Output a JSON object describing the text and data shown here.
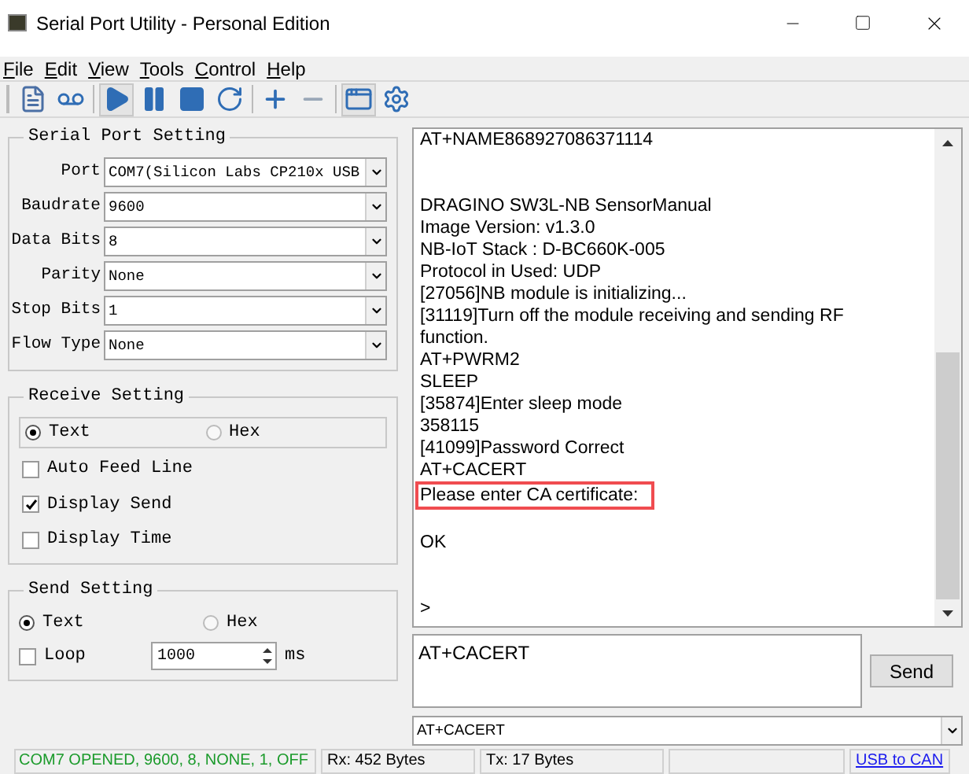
{
  "window": {
    "title": "Serial Port Utility - Personal Edition"
  },
  "menu": [
    {
      "label": "File"
    },
    {
      "label": "Edit"
    },
    {
      "label": "View"
    },
    {
      "label": "Tools"
    },
    {
      "label": "Control"
    },
    {
      "label": "Help"
    }
  ],
  "toolbar": [
    {
      "kind": "file",
      "selected": false
    },
    {
      "kind": "tape",
      "selected": false
    },
    {
      "kind": "play",
      "selected": true
    },
    {
      "kind": "pause",
      "selected": false
    },
    {
      "kind": "stop",
      "selected": false
    },
    {
      "kind": "refresh",
      "selected": false
    },
    {
      "kind": "plus",
      "selected": false
    },
    {
      "kind": "minus",
      "selected": false
    },
    {
      "kind": "window",
      "selected": true
    },
    {
      "kind": "gear",
      "selected": false
    }
  ],
  "serial_port_setting": {
    "title": "Serial Port Setting",
    "fields": [
      {
        "label": "Port",
        "value": "COM7(Silicon Labs CP210x USB"
      },
      {
        "label": "Baudrate",
        "value": "9600"
      },
      {
        "label": "Data Bits",
        "value": "8"
      },
      {
        "label": "Parity",
        "value": "None"
      },
      {
        "label": "Stop Bits",
        "value": "1"
      },
      {
        "label": "Flow Type",
        "value": "None"
      }
    ]
  },
  "receive_setting": {
    "title": "Receive Setting",
    "modes": [
      {
        "label": "Text",
        "selected": true
      },
      {
        "label": "Hex",
        "selected": false
      }
    ],
    "options": [
      {
        "label": "Auto Feed Line",
        "checked": false
      },
      {
        "label": "Display Send",
        "checked": true
      },
      {
        "label": "Display Time",
        "checked": false
      }
    ]
  },
  "send_setting": {
    "title": "Send Setting",
    "modes": [
      {
        "label": "Text",
        "selected": true
      },
      {
        "label": "Hex",
        "selected": false
      }
    ],
    "loop": {
      "label": "Loop",
      "checked": false,
      "value": "1000",
      "unit": "ms"
    }
  },
  "receive_log": [
    {
      "kind": "text",
      "text": "AT+NAME868927086371114",
      "highlighted": false
    },
    {
      "kind": "blank"
    },
    {
      "kind": "blank"
    },
    {
      "text": "DRAGINO SW3L-NB SensorManual",
      "highlighted": false
    },
    {
      "text": "Image Version: v1.3.0",
      "highlighted": false
    },
    {
      "text": "NB-IoT Stack : D-BC660K-005",
      "highlighted": false
    },
    {
      "text": "Protocol in Used: UDP",
      "highlighted": false
    },
    {
      "text": "[27056]NB module is initializing...",
      "highlighted": false
    },
    {
      "text": "[31119]Turn off the module receiving and sending RF function.",
      "highlighted": false
    },
    {
      "text": "AT+PWRM2",
      "highlighted": false
    },
    {
      "text": "SLEEP",
      "highlighted": false
    },
    {
      "text": "[35874]Enter sleep mode",
      "highlighted": false
    },
    {
      "text": "358115",
      "highlighted": false
    },
    {
      "text": "[41099]Password Correct",
      "highlighted": false
    },
    {
      "text": "AT+CACERT",
      "highlighted": false
    },
    {
      "text": "Please enter CA certificate:",
      "highlighted": true
    },
    {
      "kind": "blank"
    },
    {
      "text": "OK",
      "highlighted": false
    },
    {
      "kind": "blank"
    },
    {
      "kind": "blank"
    },
    {
      "text": ">",
      "highlighted": false
    }
  ],
  "send_input": {
    "value": "AT+CACERT"
  },
  "send_button": {
    "label": "Send"
  },
  "history_combo": {
    "value": "AT+CACERT"
  },
  "status_bar": {
    "connection": "COM7 OPENED, 9600, 8, NONE, 1, OFF",
    "rx": "Rx: 452 Bytes",
    "tx": "Tx: 17 Bytes",
    "link": "USB to CAN"
  }
}
